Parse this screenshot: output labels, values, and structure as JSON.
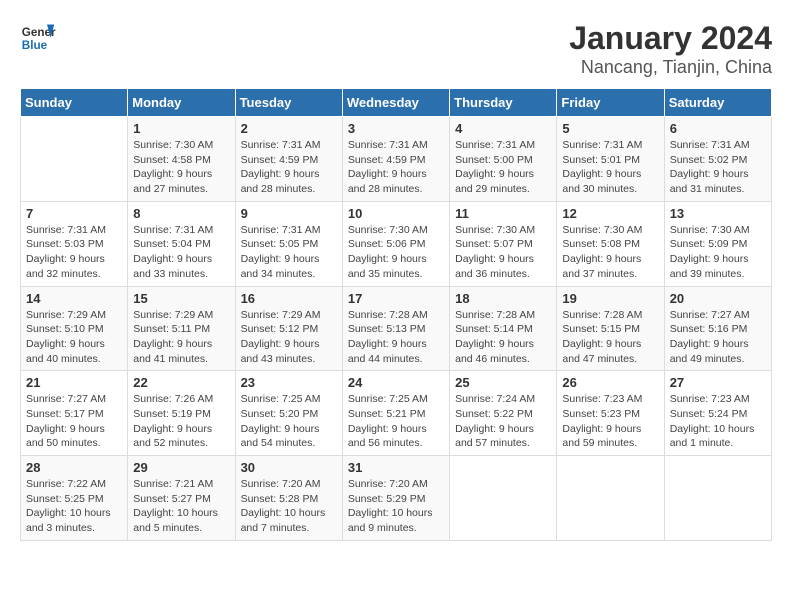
{
  "header": {
    "logo_line1": "General",
    "logo_line2": "Blue",
    "title": "January 2024",
    "subtitle": "Nancang, Tianjin, China"
  },
  "columns": [
    "Sunday",
    "Monday",
    "Tuesday",
    "Wednesday",
    "Thursday",
    "Friday",
    "Saturday"
  ],
  "weeks": [
    [
      {
        "day": "",
        "info": ""
      },
      {
        "day": "1",
        "info": "Sunrise: 7:30 AM\nSunset: 4:58 PM\nDaylight: 9 hours\nand 27 minutes."
      },
      {
        "day": "2",
        "info": "Sunrise: 7:31 AM\nSunset: 4:59 PM\nDaylight: 9 hours\nand 28 minutes."
      },
      {
        "day": "3",
        "info": "Sunrise: 7:31 AM\nSunset: 4:59 PM\nDaylight: 9 hours\nand 28 minutes."
      },
      {
        "day": "4",
        "info": "Sunrise: 7:31 AM\nSunset: 5:00 PM\nDaylight: 9 hours\nand 29 minutes."
      },
      {
        "day": "5",
        "info": "Sunrise: 7:31 AM\nSunset: 5:01 PM\nDaylight: 9 hours\nand 30 minutes."
      },
      {
        "day": "6",
        "info": "Sunrise: 7:31 AM\nSunset: 5:02 PM\nDaylight: 9 hours\nand 31 minutes."
      }
    ],
    [
      {
        "day": "7",
        "info": "Sunrise: 7:31 AM\nSunset: 5:03 PM\nDaylight: 9 hours\nand 32 minutes."
      },
      {
        "day": "8",
        "info": "Sunrise: 7:31 AM\nSunset: 5:04 PM\nDaylight: 9 hours\nand 33 minutes."
      },
      {
        "day": "9",
        "info": "Sunrise: 7:31 AM\nSunset: 5:05 PM\nDaylight: 9 hours\nand 34 minutes."
      },
      {
        "day": "10",
        "info": "Sunrise: 7:30 AM\nSunset: 5:06 PM\nDaylight: 9 hours\nand 35 minutes."
      },
      {
        "day": "11",
        "info": "Sunrise: 7:30 AM\nSunset: 5:07 PM\nDaylight: 9 hours\nand 36 minutes."
      },
      {
        "day": "12",
        "info": "Sunrise: 7:30 AM\nSunset: 5:08 PM\nDaylight: 9 hours\nand 37 minutes."
      },
      {
        "day": "13",
        "info": "Sunrise: 7:30 AM\nSunset: 5:09 PM\nDaylight: 9 hours\nand 39 minutes."
      }
    ],
    [
      {
        "day": "14",
        "info": "Sunrise: 7:29 AM\nSunset: 5:10 PM\nDaylight: 9 hours\nand 40 minutes."
      },
      {
        "day": "15",
        "info": "Sunrise: 7:29 AM\nSunset: 5:11 PM\nDaylight: 9 hours\nand 41 minutes."
      },
      {
        "day": "16",
        "info": "Sunrise: 7:29 AM\nSunset: 5:12 PM\nDaylight: 9 hours\nand 43 minutes."
      },
      {
        "day": "17",
        "info": "Sunrise: 7:28 AM\nSunset: 5:13 PM\nDaylight: 9 hours\nand 44 minutes."
      },
      {
        "day": "18",
        "info": "Sunrise: 7:28 AM\nSunset: 5:14 PM\nDaylight: 9 hours\nand 46 minutes."
      },
      {
        "day": "19",
        "info": "Sunrise: 7:28 AM\nSunset: 5:15 PM\nDaylight: 9 hours\nand 47 minutes."
      },
      {
        "day": "20",
        "info": "Sunrise: 7:27 AM\nSunset: 5:16 PM\nDaylight: 9 hours\nand 49 minutes."
      }
    ],
    [
      {
        "day": "21",
        "info": "Sunrise: 7:27 AM\nSunset: 5:17 PM\nDaylight: 9 hours\nand 50 minutes."
      },
      {
        "day": "22",
        "info": "Sunrise: 7:26 AM\nSunset: 5:19 PM\nDaylight: 9 hours\nand 52 minutes."
      },
      {
        "day": "23",
        "info": "Sunrise: 7:25 AM\nSunset: 5:20 PM\nDaylight: 9 hours\nand 54 minutes."
      },
      {
        "day": "24",
        "info": "Sunrise: 7:25 AM\nSunset: 5:21 PM\nDaylight: 9 hours\nand 56 minutes."
      },
      {
        "day": "25",
        "info": "Sunrise: 7:24 AM\nSunset: 5:22 PM\nDaylight: 9 hours\nand 57 minutes."
      },
      {
        "day": "26",
        "info": "Sunrise: 7:23 AM\nSunset: 5:23 PM\nDaylight: 9 hours\nand 59 minutes."
      },
      {
        "day": "27",
        "info": "Sunrise: 7:23 AM\nSunset: 5:24 PM\nDaylight: 10 hours\nand 1 minute."
      }
    ],
    [
      {
        "day": "28",
        "info": "Sunrise: 7:22 AM\nSunset: 5:25 PM\nDaylight: 10 hours\nand 3 minutes."
      },
      {
        "day": "29",
        "info": "Sunrise: 7:21 AM\nSunset: 5:27 PM\nDaylight: 10 hours\nand 5 minutes."
      },
      {
        "day": "30",
        "info": "Sunrise: 7:20 AM\nSunset: 5:28 PM\nDaylight: 10 hours\nand 7 minutes."
      },
      {
        "day": "31",
        "info": "Sunrise: 7:20 AM\nSunset: 5:29 PM\nDaylight: 10 hours\nand 9 minutes."
      },
      {
        "day": "",
        "info": ""
      },
      {
        "day": "",
        "info": ""
      },
      {
        "day": "",
        "info": ""
      }
    ]
  ]
}
